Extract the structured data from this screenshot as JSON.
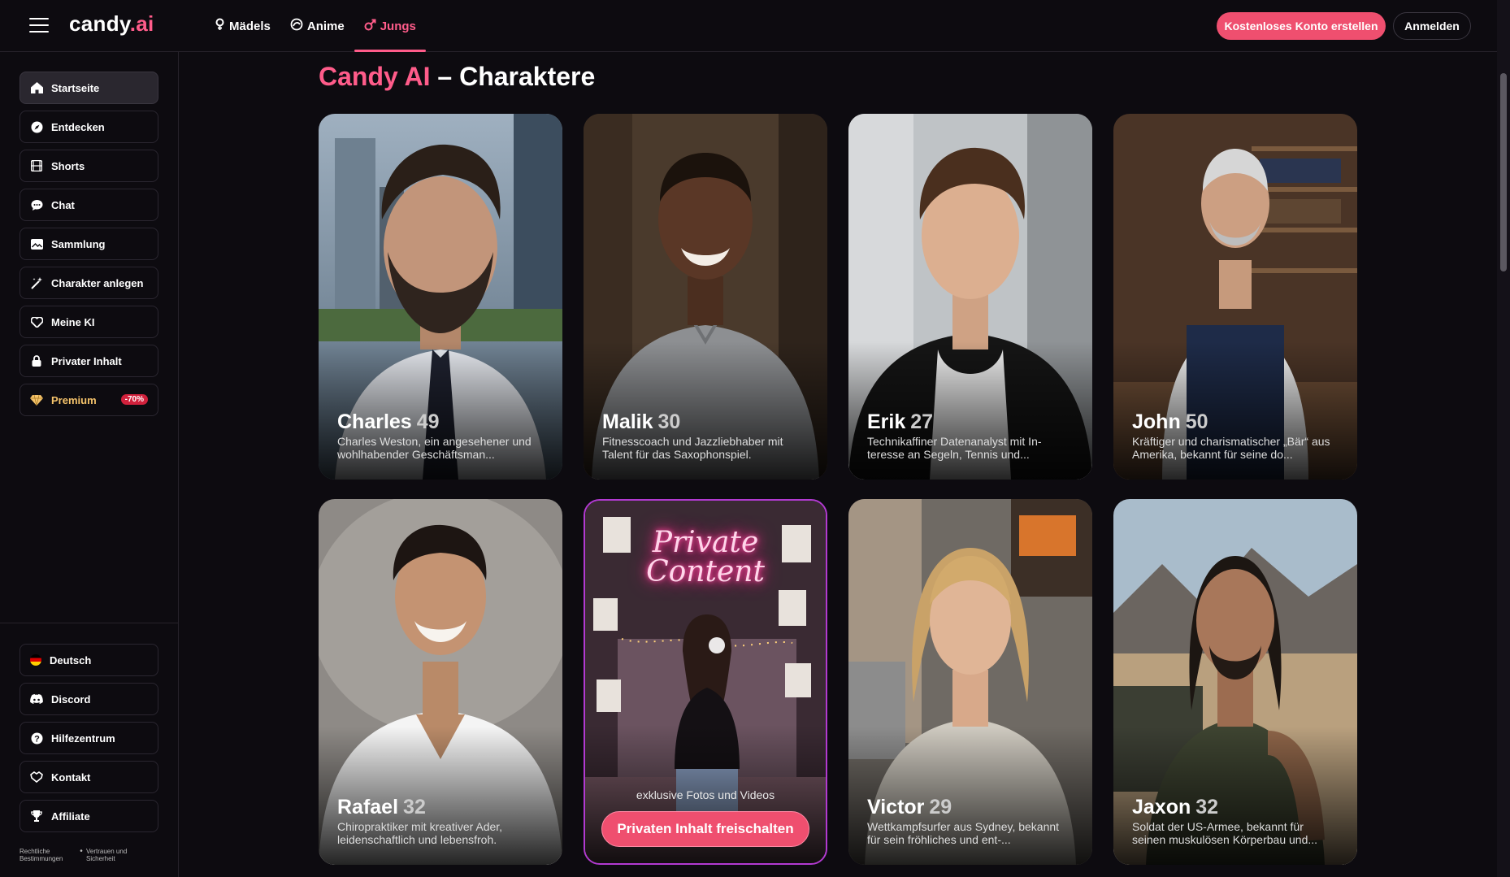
{
  "brand": {
    "name": "candy",
    "suffix": ".ai"
  },
  "nav": {
    "tabs": [
      {
        "label": "Mädels",
        "icon": "female-icon"
      },
      {
        "label": "Anime",
        "icon": "anime-icon"
      },
      {
        "label": "Jungs",
        "icon": "male-icon",
        "active": true
      }
    ]
  },
  "header": {
    "signup_label": "Kostenloses Konto erstellen",
    "login_label": "Anmelden"
  },
  "sidebar": {
    "items": [
      {
        "label": "Startseite",
        "icon": "home-icon",
        "active": true
      },
      {
        "label": "Entdecken",
        "icon": "compass-icon"
      },
      {
        "label": "Shorts",
        "icon": "film-icon"
      },
      {
        "label": "Chat",
        "icon": "chat-icon"
      },
      {
        "label": "Sammlung",
        "icon": "collection-icon"
      },
      {
        "label": "Charakter anlegen",
        "icon": "magic-wand-icon"
      },
      {
        "label": "Meine KI",
        "icon": "heart-icon"
      },
      {
        "label": "Privater Inhalt",
        "icon": "lock-icon"
      },
      {
        "label": "Premium",
        "icon": "diamond-icon",
        "badge": "-70%"
      }
    ],
    "bottom_items": [
      {
        "label": "Deutsch",
        "icon": "flag-de-icon"
      },
      {
        "label": "Discord",
        "icon": "discord-icon"
      },
      {
        "label": "Hilfezentrum",
        "icon": "help-icon"
      },
      {
        "label": "Kontakt",
        "icon": "contact-icon"
      },
      {
        "label": "Affiliate",
        "icon": "trophy-icon"
      }
    ],
    "footer_links": [
      "Rechtliche Bestimmungen",
      "Vertrauen und Sicherheit"
    ]
  },
  "main": {
    "title_brand": "Candy AI",
    "title_rest": " – Charaktere",
    "characters": [
      {
        "name": "Charles",
        "age": "49",
        "desc": "Charles Weston, ein angesehener und wohlhabender Geschäftsman..."
      },
      {
        "name": "Malik",
        "age": "30",
        "desc": "Fitnesscoach und Jazzliebhaber mit Talent für das Saxophonspiel."
      },
      {
        "name": "Erik",
        "age": "27",
        "desc": "Technikaffiner Datenanalyst mit In­teresse an Segeln, Tennis und..."
      },
      {
        "name": "John",
        "age": "50",
        "desc": "Kräftiger und charismatischer „Bär“ aus Amerika, bekannt für seine do..."
      },
      {
        "name": "Rafael",
        "age": "32",
        "desc": "Chiropraktiker mit kreativer Ader, leidenschaftlich und lebensfroh."
      },
      {
        "name": "Victor",
        "age": "29",
        "desc": "Wettkampfsurfer aus Sydney, be­kannt für sein fröhliches und ent-..."
      },
      {
        "name": "Jaxon",
        "age": "32",
        "desc": "Soldat der US-Armee, bekannt für seinen muskulösen Körperbau und..."
      }
    ],
    "private_card": {
      "neon_line1": "Private",
      "neon_line2": "Content",
      "subtitle": "exklusive Fotos und Videos",
      "button": "Privaten Inhalt freischalten"
    }
  },
  "colors": {
    "accent": "#ef4f6f",
    "brand_pink": "#ff5c8a",
    "premium": "#f5c36b",
    "private_border": "#b23ad1"
  }
}
